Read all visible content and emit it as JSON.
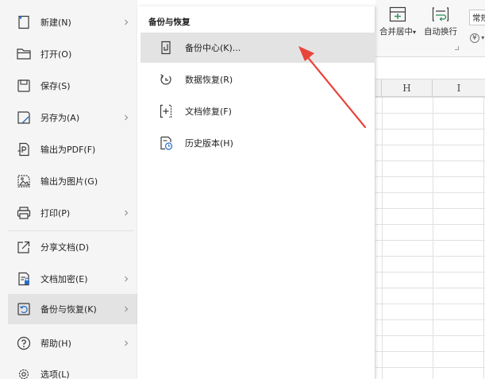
{
  "ribbon": {
    "merge_center": "合并居中",
    "auto_wrap": "自动换行",
    "normal": "常规",
    "currency_symbol": "¥"
  },
  "columns": [
    "H",
    "I"
  ],
  "file_menu": {
    "items": [
      {
        "label": "新建(N)"
      },
      {
        "label": "打开(O)"
      },
      {
        "label": "保存(S)"
      },
      {
        "label": "另存为(A)"
      },
      {
        "label": "输出为PDF(F)"
      },
      {
        "label": "输出为图片(G)"
      },
      {
        "label": "打印(P)"
      },
      {
        "label": "分享文档(D)"
      },
      {
        "label": "文档加密(E)"
      },
      {
        "label": "备份与恢复(K)"
      },
      {
        "label": "帮助(H)"
      },
      {
        "label": "选项(L)"
      }
    ]
  },
  "submenu": {
    "title": "备份与恢复",
    "items": [
      {
        "label": "备份中心(K)..."
      },
      {
        "label": "数据恢复(R)"
      },
      {
        "label": "文档修复(F)"
      },
      {
        "label": "历史版本(H)"
      }
    ]
  },
  "colors": {
    "menu_bg": "#f5f5f5",
    "hover_bg": "#e3e3e3",
    "annotation": "#e8453c",
    "icon_stroke": "#3a3a3a",
    "accent_green": "#2e8b57",
    "accent_blue": "#2b6cc4"
  }
}
